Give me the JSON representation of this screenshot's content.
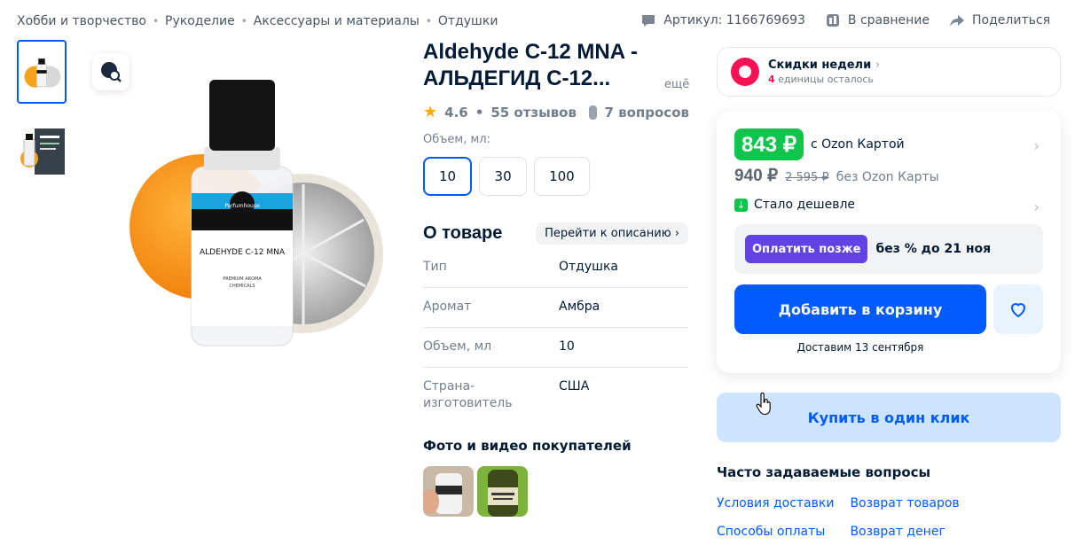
{
  "breadcrumb": [
    "Хобби и творчество",
    "Рукоделие",
    "Аксессуары и материалы",
    "Отдушки"
  ],
  "top_actions": {
    "article": "Артикул: 1166769693",
    "compare": "В сравнение",
    "share": "Поделиться"
  },
  "product": {
    "title": "Aldehyde C-12 MNA - АЛЬДЕГИД С-12...",
    "more": "ещё",
    "rating": "4.6",
    "reviews": "55 отзывов",
    "rating_sep": "•",
    "questions": "7 вопросов",
    "bottle_label": "ALDEHYDE C-12 MNA",
    "bottle_brand": "Parfumhouse",
    "bottle_sub1": "PREMIUM AROMA",
    "bottle_sub2": "CHEMICALS"
  },
  "volume": {
    "label": "Объем, мл:",
    "options": [
      "10",
      "30",
      "100"
    ],
    "selected": "10"
  },
  "about": {
    "title": "О товаре",
    "link": "Перейти к описанию",
    "specs": [
      {
        "key": "Тип",
        "value": "Отдушка"
      },
      {
        "key": "Аромат",
        "value": "Амбра"
      },
      {
        "key": "Объем, мл",
        "value": "10"
      },
      {
        "key": "Страна-изготовитель",
        "value": "США"
      }
    ]
  },
  "photos": {
    "title": "Фото и видео покупателей"
  },
  "promo": {
    "title": "Скидки недели",
    "count": "4",
    "sub": "единицы осталось"
  },
  "price": {
    "card_price": "843 ₽",
    "card_label": "с Ozon Картой",
    "nocard_price": "940 ₽",
    "old_price": "2 595 ₽",
    "nocard_label": "без Ozon Карты",
    "cheaper": "Стало дешевле"
  },
  "pay_later": {
    "button": "Оплатить позже",
    "text": "без % до 21 ноя"
  },
  "actions": {
    "add_to_cart": "Добавить в корзину",
    "delivery": "Доставим 13 сентября",
    "one_click": "Купить в один клик"
  },
  "faq": {
    "title": "Часто задаваемые вопросы",
    "links": [
      "Условия доставки",
      "Возврат товаров",
      "Способы оплаты",
      "Возврат денег"
    ]
  },
  "colors": {
    "accent": "#005bff",
    "price_green": "#10c44c",
    "promo_pink": "#f91155",
    "pay_later_purple": "#6242e3"
  }
}
